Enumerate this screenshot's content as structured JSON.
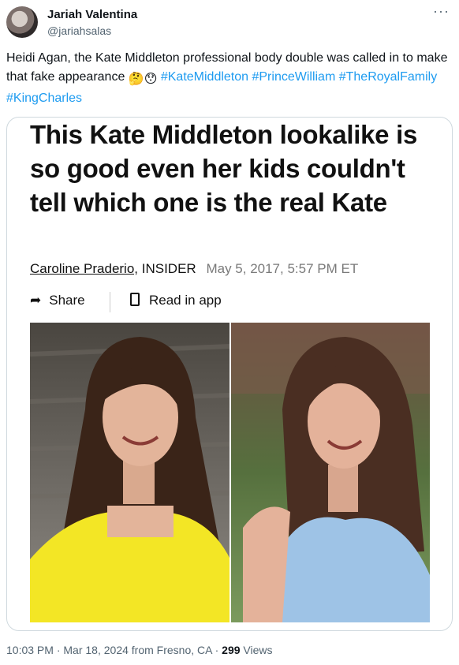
{
  "user": {
    "name": "Jariah Valentina",
    "handle": "@jariahsalas"
  },
  "tweet": {
    "text_part1": "Heidi Agan, the Kate Middleton professional body double was called in to make that fake appearance ",
    "emoji1": "🤔",
    "emoji2": "😯",
    "hashtags": [
      "#KateMiddleton",
      "#PrinceWilliam",
      "#TheRoyalFamily",
      "#KingCharles"
    ]
  },
  "article": {
    "headline": "This Kate Middleton lookalike is so good even her kids couldn't tell which one is the real Kate",
    "author": "Caroline Praderio,",
    "publication": "INSIDER",
    "date": "May 5, 2017, 5:57 PM ET",
    "share_label": "Share",
    "read_in_app_label": "Read in app"
  },
  "footer": {
    "time": "10:03 PM",
    "date": "Mar 18, 2024",
    "location": "from Fresno, CA",
    "views_count": "299",
    "views_label": "Views"
  },
  "icons": {
    "more": "more-dots-icon",
    "share": "share-arrow-icon",
    "phone": "phone-icon"
  },
  "colors": {
    "link": "#1d9bf0",
    "secondary_text": "#536471",
    "border": "#cfd9de"
  }
}
